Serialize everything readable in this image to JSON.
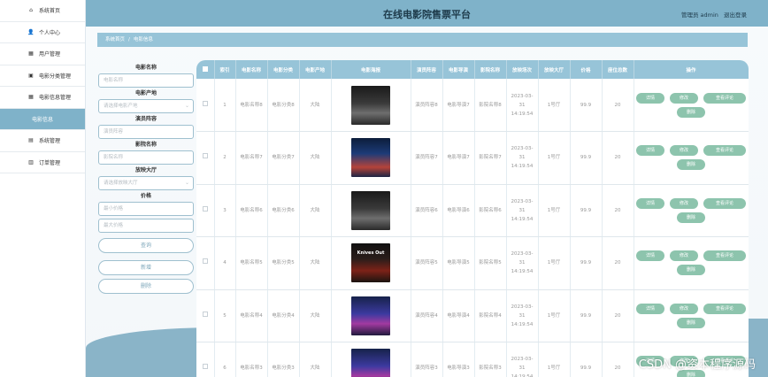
{
  "header": {
    "title": "在线电影院售票平台",
    "user_label": "管理员 admin",
    "logout_label": "退出登录"
  },
  "sidebar": {
    "items": [
      {
        "label": "系统首页",
        "icon": "home-icon",
        "glyph": "⌂"
      },
      {
        "label": "个人中心",
        "icon": "user-icon",
        "glyph": "👤"
      },
      {
        "label": "用户管理",
        "icon": "grid-icon",
        "glyph": "▦"
      },
      {
        "label": "电影分类管理",
        "icon": "calendar-icon",
        "glyph": "▣"
      },
      {
        "label": "电影信息管理",
        "icon": "grid-icon",
        "glyph": "▦"
      },
      {
        "label": "电影信息",
        "icon": "",
        "glyph": ""
      },
      {
        "label": "系统管理",
        "icon": "briefcase-icon",
        "glyph": "▤"
      },
      {
        "label": "订单管理",
        "icon": "chart-icon",
        "glyph": "▥"
      }
    ],
    "active_index": 5
  },
  "breadcrumb": {
    "home": "系统首页",
    "current": "电影信息"
  },
  "search": {
    "name_label": "电影名称",
    "name_placeholder": "电影名称",
    "origin_label": "电影产地",
    "origin_placeholder": "请选择电影产地",
    "cast_label": "演员阵容",
    "cast_placeholder": "演员阵容",
    "film_label": "影院名称",
    "film_placeholder": "影院名称",
    "hall_label": "放映大厅",
    "hall_placeholder": "请选择放映大厅",
    "price_label": "价格",
    "price_min_placeholder": "最小价格",
    "price_max_placeholder": "最大价格",
    "query_button": "查询",
    "add_button": "新增",
    "delete_button": "删除"
  },
  "table": {
    "columns": [
      "索引",
      "电影名称",
      "电影分类",
      "电影产地",
      "电影海报",
      "演员阵容",
      "电影导演",
      "影院名称",
      "放映场次",
      "放映大厅",
      "价格",
      "座位总数",
      "操作"
    ],
    "rows": [
      {
        "index": "1",
        "name": "电影名称8",
        "category": "电影分类8",
        "origin": "大陆",
        "poster": "dark",
        "poster_text": "",
        "cast": "演员阵容8",
        "director": "电影导演7",
        "cinema": "影院名称8",
        "session": "2023-03-31 14:19:54",
        "hall": "1号厅",
        "price": "99.9",
        "seats": "20"
      },
      {
        "index": "2",
        "name": "电影名称7",
        "category": "电影分类7",
        "origin": "大陆",
        "poster": "blue",
        "poster_text": "",
        "cast": "演员阵容7",
        "director": "电影导演7",
        "cinema": "影院名称7",
        "session": "2023-03-31 14:19:54",
        "hall": "1号厅",
        "price": "99.9",
        "seats": "20"
      },
      {
        "index": "3",
        "name": "电影名称6",
        "category": "电影分类6",
        "origin": "大陆",
        "poster": "dark",
        "poster_text": "",
        "cast": "演员阵容6",
        "director": "电影导演6",
        "cinema": "影院名称6",
        "session": "2023-03-31 14:19:54",
        "hall": "1号厅",
        "price": "99.9",
        "seats": "20"
      },
      {
        "index": "4",
        "name": "电影名称5",
        "category": "电影分类5",
        "origin": "大陆",
        "poster": "knives",
        "poster_text": "Knives Out",
        "cast": "演员阵容5",
        "director": "电影导演5",
        "cinema": "影院名称5",
        "session": "2023-03-31 14:19:54",
        "hall": "1号厅",
        "price": "99.9",
        "seats": "20"
      },
      {
        "index": "5",
        "name": "电影名称4",
        "category": "电影分类4",
        "origin": "大陆",
        "poster": "purple",
        "poster_text": "",
        "cast": "演员阵容4",
        "director": "电影导演4",
        "cinema": "影院名称4",
        "session": "2023-03-31 14:19:54",
        "hall": "1号厅",
        "price": "99.9",
        "seats": "20"
      },
      {
        "index": "6",
        "name": "电影名称3",
        "category": "电影分类3",
        "origin": "大陆",
        "poster": "purple",
        "poster_text": "",
        "cast": "演员阵容3",
        "director": "电影导演3",
        "cinema": "影院名称3",
        "session": "2023-03-31 14:19:54",
        "hall": "1号厅",
        "price": "99.9",
        "seats": "20"
      }
    ],
    "actions": {
      "detail": "详情",
      "edit": "修改",
      "comments": "查看评论",
      "delete": "删除"
    }
  },
  "watermark": "CSDN @资本程序源码",
  "colors": {
    "header": "#7fb2c9",
    "breadcrumb": "#97c4d8",
    "action_button": "#8dc4ad"
  }
}
